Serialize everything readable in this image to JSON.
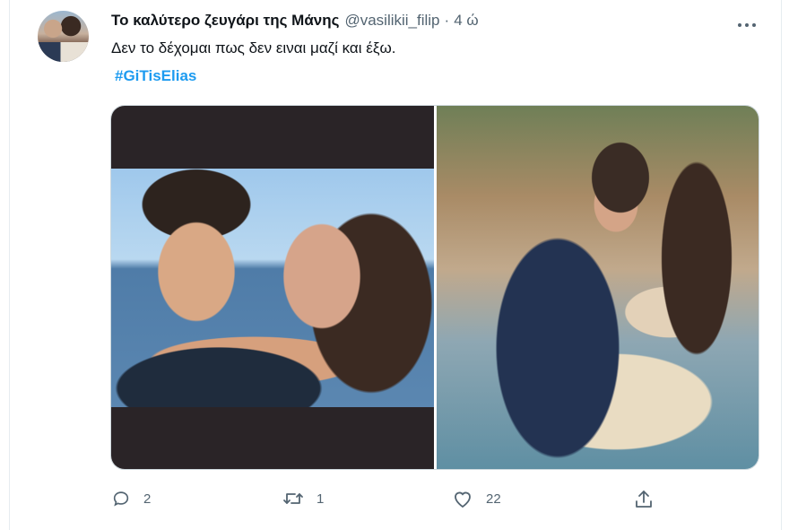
{
  "tweet": {
    "display_name": "Το καλύτερο ζευγάρι της Μάνης",
    "handle": "@vasilikii_filip",
    "separator": "·",
    "time": "4 ώ",
    "more_icon": "more-horizontal-icon",
    "text": "Δεν το δέχομαι πως δεν ειναι μαζί και έξω.",
    "hashtag": "#GiTisElias",
    "accent_color": "#1d9bf0"
  },
  "media": {
    "count": 2
  },
  "actions": {
    "reply": {
      "icon": "reply-icon",
      "count": "2"
    },
    "retweet": {
      "icon": "retweet-icon",
      "count": "1"
    },
    "like": {
      "icon": "heart-icon",
      "count": "22"
    },
    "share": {
      "icon": "share-icon"
    }
  }
}
